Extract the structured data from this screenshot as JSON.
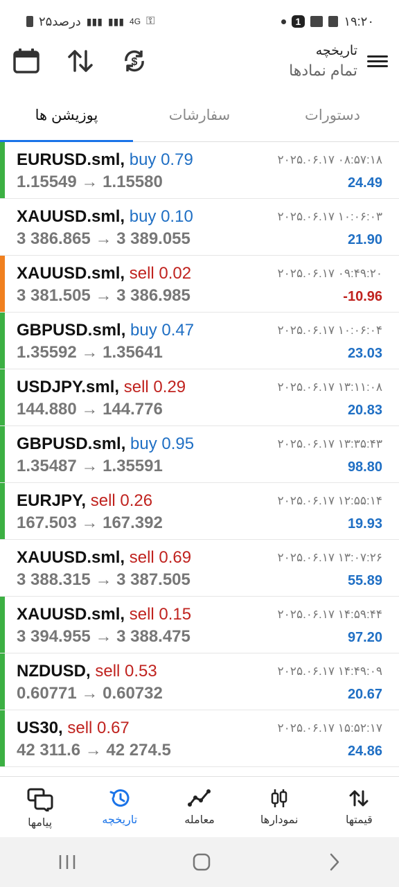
{
  "status_bar": {
    "time": "۱۹:۲۰",
    "battery": "۲۵درصد",
    "notification_count": "1",
    "network": "4G"
  },
  "header": {
    "title": "تاریخچه",
    "subtitle": "تمام نمادها"
  },
  "tabs": [
    {
      "label": "دستورات",
      "active": false
    },
    {
      "label": "سفارشات",
      "active": false
    },
    {
      "label": "پوزیشن ها",
      "active": true
    }
  ],
  "positions": [
    {
      "symbol": "EURUSD.sml,",
      "side": "buy 0.79",
      "direction": "buy",
      "prices": "1.15549 → 1.15580",
      "time": "۲۰۲۵.۰۶.۱۷ ۰۸:۵۷:۱۸",
      "profit": "24.49",
      "stripe": "#3cb043"
    },
    {
      "symbol": "XAUUSD.sml,",
      "side": "buy 0.10",
      "direction": "buy",
      "prices": "3 386.865 → 3 389.055",
      "time": "۲۰۲۵.۰۶.۱۷ ۱۰:۰۶:۰۳",
      "profit": "21.90",
      "stripe": "#ffffff"
    },
    {
      "symbol": "XAUUSD.sml,",
      "side": "sell 0.02",
      "direction": "sell",
      "prices": "3 381.505 → 3 386.985",
      "time": "۲۰۲۵.۰۶.۱۷ ۰۹:۴۹:۲۰",
      "profit": "-10.96",
      "stripe": "#f0801f"
    },
    {
      "symbol": "GBPUSD.sml,",
      "side": "buy 0.47",
      "direction": "buy",
      "prices": "1.35592 → 1.35641",
      "time": "۲۰۲۵.۰۶.۱۷ ۱۰:۰۶:۰۴",
      "profit": "23.03",
      "stripe": "#3cb043"
    },
    {
      "symbol": "USDJPY.sml,",
      "side": "sell 0.29",
      "direction": "sell",
      "prices": "144.880 → 144.776",
      "time": "۲۰۲۵.۰۶.۱۷ ۱۳:۱۱:۰۸",
      "profit": "20.83",
      "stripe": "#3cb043"
    },
    {
      "symbol": "GBPUSD.sml,",
      "side": "buy 0.95",
      "direction": "buy",
      "prices": "1.35487 → 1.35591",
      "time": "۲۰۲۵.۰۶.۱۷ ۱۳:۳۵:۴۳",
      "profit": "98.80",
      "stripe": "#3cb043"
    },
    {
      "symbol": "EURJPY,",
      "side": "sell 0.26",
      "direction": "sell",
      "prices": "167.503 → 167.392",
      "time": "۲۰۲۵.۰۶.۱۷ ۱۲:۵۵:۱۴",
      "profit": "19.93",
      "stripe": "#3cb043"
    },
    {
      "symbol": "XAUUSD.sml,",
      "side": "sell 0.69",
      "direction": "sell",
      "prices": "3 388.315 → 3 387.505",
      "time": "۲۰۲۵.۰۶.۱۷ ۱۳:۰۷:۲۶",
      "profit": "55.89",
      "stripe": "#ffffff"
    },
    {
      "symbol": "XAUUSD.sml,",
      "side": "sell 0.15",
      "direction": "sell",
      "prices": "3 394.955 → 3 388.475",
      "time": "۲۰۲۵.۰۶.۱۷ ۱۴:۵۹:۴۴",
      "profit": "97.20",
      "stripe": "#3cb043"
    },
    {
      "symbol": "NZDUSD,",
      "side": "sell 0.53",
      "direction": "sell",
      "prices": "0.60771 → 0.60732",
      "time": "۲۰۲۵.۰۶.۱۷ ۱۴:۴۹:۰۹",
      "profit": "20.67",
      "stripe": "#3cb043"
    },
    {
      "symbol": "US30,",
      "side": "sell 0.67",
      "direction": "sell",
      "prices": "42 311.6 → 42 274.5",
      "time": "۲۰۲۵.۰۶.۱۷ ۱۵:۵۲:۱۷",
      "profit": "24.86",
      "stripe": "#3cb043"
    }
  ],
  "bottom_nav": [
    {
      "label": "قیمتها",
      "icon": "quotes-icon",
      "active": false
    },
    {
      "label": "نمودارها",
      "icon": "charts-icon",
      "active": false
    },
    {
      "label": "معامله",
      "icon": "trade-icon",
      "active": false
    },
    {
      "label": "تاریخچه",
      "icon": "history-icon",
      "active": true
    },
    {
      "label": "پیامها",
      "icon": "messages-icon",
      "active": false
    }
  ],
  "colors": {
    "accent": "#1a73e8",
    "buy": "#1f6fc4",
    "sell": "#c0231f",
    "profit_positive": "#1f6fc4",
    "profit_negative": "#c0231f"
  }
}
